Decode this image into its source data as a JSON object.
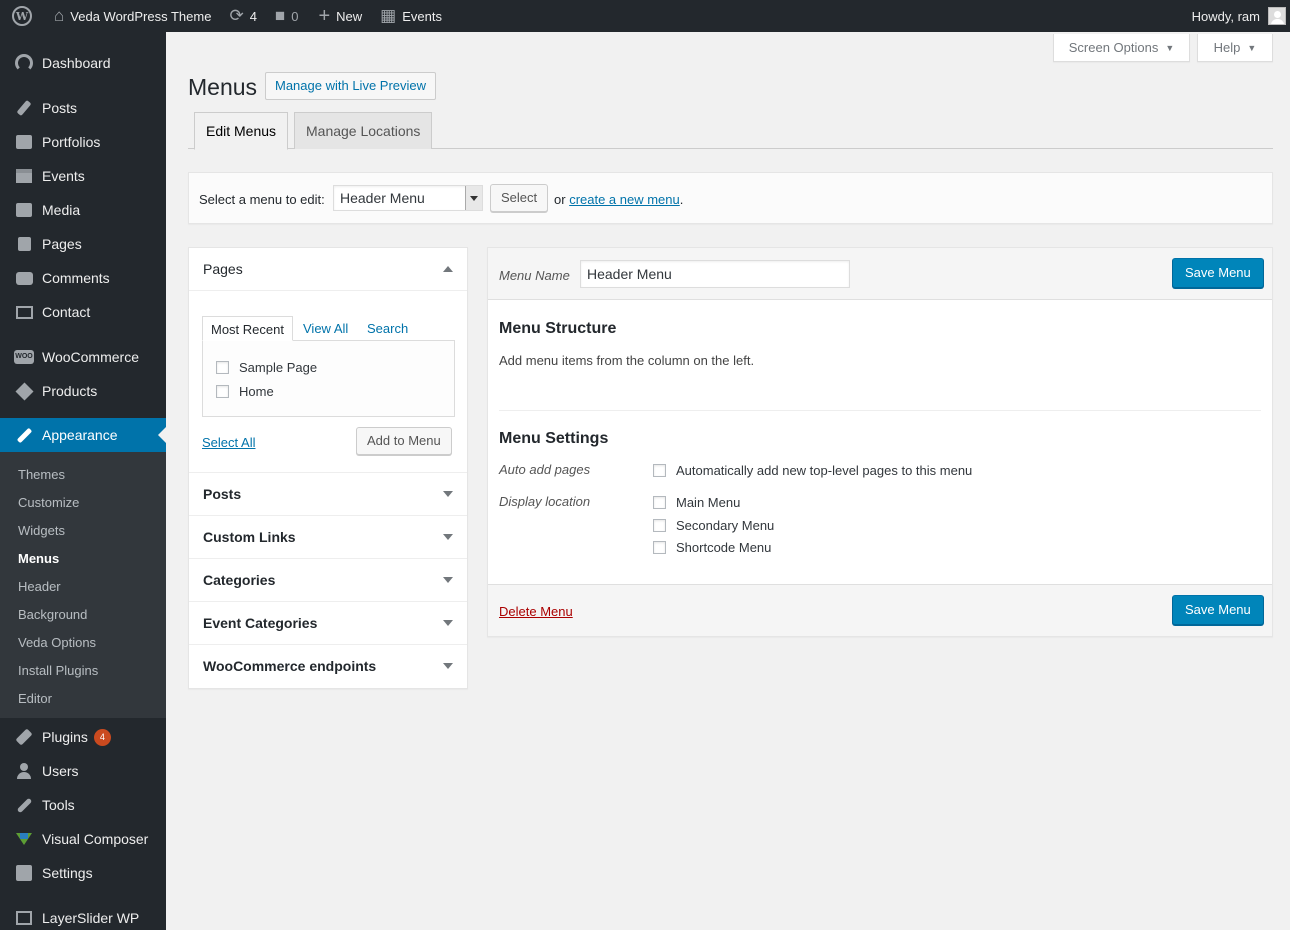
{
  "adminbar": {
    "site_name": "Veda WordPress Theme",
    "updates_count": "4",
    "comments_count": "0",
    "new_label": "New",
    "events_label": "Events",
    "howdy": "Howdy, ram"
  },
  "sidebar": {
    "items": [
      {
        "label": "Dashboard",
        "icon": "dashboard-icon"
      },
      {
        "label": "Posts",
        "icon": "pin-icon"
      },
      {
        "label": "Portfolios",
        "icon": "portfolio-icon"
      },
      {
        "label": "Events",
        "icon": "calendar-icon"
      },
      {
        "label": "Media",
        "icon": "media-icon"
      },
      {
        "label": "Pages",
        "icon": "pages-icon"
      },
      {
        "label": "Comments",
        "icon": "comment-icon"
      },
      {
        "label": "Contact",
        "icon": "mail-icon"
      },
      {
        "label": "WooCommerce",
        "icon": "woo-icon"
      },
      {
        "label": "Products",
        "icon": "cube-icon"
      },
      {
        "label": "Appearance",
        "icon": "brush-icon"
      },
      {
        "label": "Plugins",
        "icon": "plugin-icon"
      },
      {
        "label": "Users",
        "icon": "user-icon"
      },
      {
        "label": "Tools",
        "icon": "wrench-icon"
      },
      {
        "label": "Visual Composer",
        "icon": "visual-composer-icon"
      },
      {
        "label": "Settings",
        "icon": "settings-icon"
      },
      {
        "label": "LayerSlider WP",
        "icon": "layers-icon"
      }
    ],
    "plugins_badge": "4",
    "appearance_sub": [
      "Themes",
      "Customize",
      "Widgets",
      "Menus",
      "Header",
      "Background",
      "Veda Options",
      "Install Plugins",
      "Editor"
    ]
  },
  "screen_meta": {
    "screen_options": "Screen Options",
    "help": "Help"
  },
  "page": {
    "title": "Menus",
    "live_preview": "Manage with Live Preview",
    "tabs": [
      "Edit Menus",
      "Manage Locations"
    ]
  },
  "manage": {
    "label": "Select a menu to edit:",
    "selected_menu": "Header Menu",
    "select_button": "Select",
    "or": "or",
    "create_link": "create a new menu",
    "period": "."
  },
  "accordion": {
    "pages_title": "Pages",
    "inner_tabs": [
      "Most Recent",
      "View All",
      "Search"
    ],
    "pages": [
      "Sample Page",
      "Home"
    ],
    "select_all": "Select All",
    "add_to_menu": "Add to Menu",
    "sections": [
      "Posts",
      "Custom Links",
      "Categories",
      "Event Categories",
      "WooCommerce endpoints"
    ]
  },
  "menu_edit": {
    "menu_name_label": "Menu Name",
    "menu_name_value": "Header Menu",
    "save_button": "Save Menu",
    "structure_title": "Menu Structure",
    "structure_instructions": "Add menu items from the column on the left.",
    "settings_title": "Menu Settings",
    "auto_add_label": "Auto add pages",
    "auto_add_option": "Automatically add new top-level pages to this menu",
    "display_location_label": "Display location",
    "locations": [
      "Main Menu",
      "Secondary Menu",
      "Shortcode Menu"
    ],
    "delete_link": "Delete Menu"
  },
  "colors": {
    "admin_dark": "#23282d",
    "submenu": "#32373c",
    "accent": "#0073aa",
    "primary_button": "#0085ba",
    "delete": "#aa0000",
    "badge": "#ca4a1f"
  }
}
